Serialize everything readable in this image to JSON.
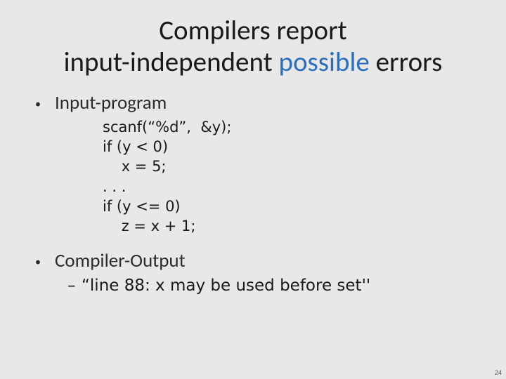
{
  "title": {
    "line1": "Compilers report",
    "line2_a": "input-independent  ",
    "line2_possible": "possible",
    "line2_b": " errors"
  },
  "bullets": {
    "b1_label": "Input-program",
    "b1_code": "scanf(“%d”,  &y);\nif (y < 0)\n    x = 5;\n. . .\nif (y <= 0)\n    z = x + 1;",
    "b2_label": "Compiler-Output",
    "b2_sub": "“line 88: x may be used before set''"
  },
  "dots": {
    "bullet": "•",
    "dash": "–"
  },
  "page_number": "24"
}
